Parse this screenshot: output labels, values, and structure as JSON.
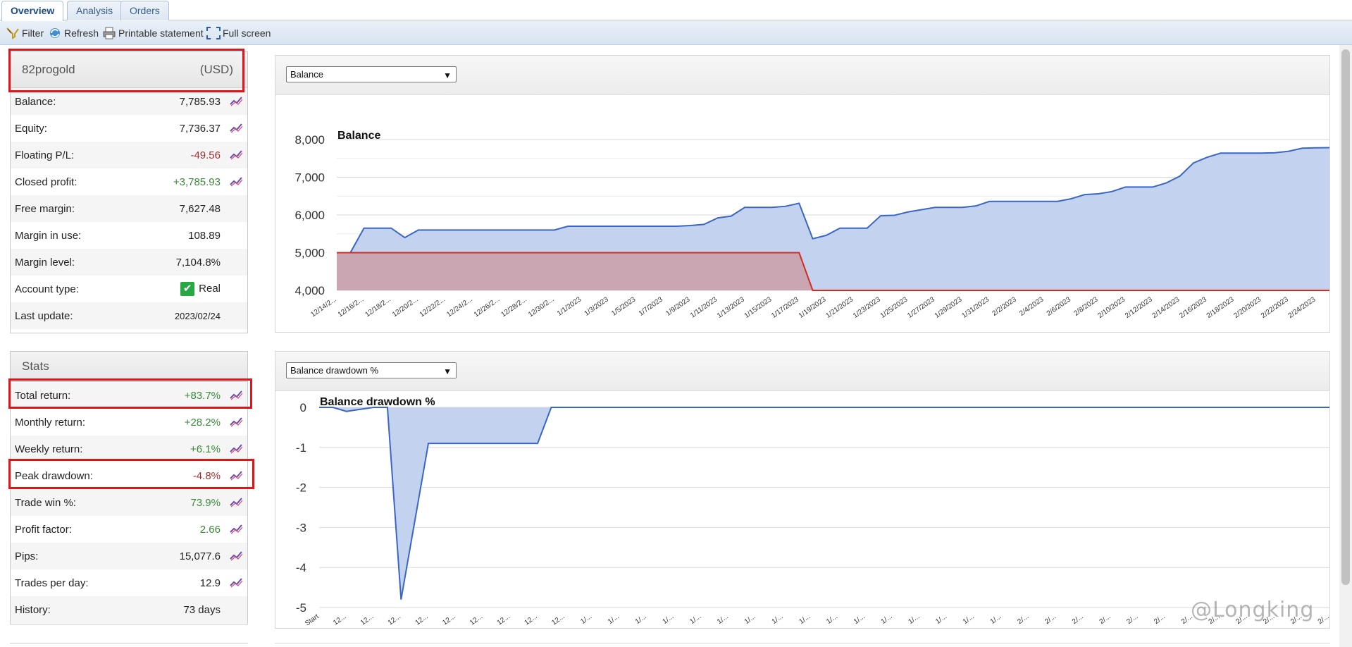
{
  "tabs": [
    {
      "label": "Overview",
      "active": true
    },
    {
      "label": "Analysis",
      "active": false
    },
    {
      "label": "Orders",
      "active": false
    }
  ],
  "toolbar": {
    "filter": "Filter",
    "refresh": "Refresh",
    "print": "Printable statement",
    "fullscreen": "Full screen"
  },
  "account": {
    "name": "82progold",
    "currency": "(USD)",
    "rows": [
      {
        "label": "Balance:",
        "value": "7,785.93",
        "style": "",
        "icon": true
      },
      {
        "label": "Equity:",
        "value": "7,736.37",
        "style": "",
        "icon": true
      },
      {
        "label": "Floating P/L:",
        "value": "-49.56",
        "style": "neg",
        "icon": true
      },
      {
        "label": "Closed profit:",
        "value": "+3,785.93",
        "style": "pos",
        "icon": true
      },
      {
        "label": "Free margin:",
        "value": "7,627.48",
        "style": "",
        "icon": false
      },
      {
        "label": "Margin in use:",
        "value": "108.89",
        "style": "",
        "icon": false
      },
      {
        "label": "Margin level:",
        "value": "7,104.8%",
        "style": "",
        "icon": false
      },
      {
        "label": "Account type:",
        "value": "Real",
        "style": "",
        "icon": false,
        "check": true
      },
      {
        "label": "Last update:",
        "value": "2023/02/24",
        "style": "small",
        "icon": false
      }
    ]
  },
  "stats": {
    "title": "Stats",
    "rows": [
      {
        "label": "Total return:",
        "value": "+83.7%",
        "style": "pos",
        "icon": true
      },
      {
        "label": "Monthly return:",
        "value": "+28.2%",
        "style": "pos",
        "icon": true
      },
      {
        "label": "Weekly return:",
        "value": "+6.1%",
        "style": "pos",
        "icon": true
      },
      {
        "label": "Peak drawdown:",
        "value": "-4.8%",
        "style": "neg",
        "icon": true
      },
      {
        "label": "Trade win %:",
        "value": "73.9%",
        "style": "pos",
        "icon": true
      },
      {
        "label": "Profit factor:",
        "value": "2.66",
        "style": "pos",
        "icon": true
      },
      {
        "label": "Pips:",
        "value": "15,077.6",
        "style": "",
        "icon": true
      },
      {
        "label": "Trades per day:",
        "value": "12.9",
        "style": "",
        "icon": true
      },
      {
        "label": "History:",
        "value": "73 days",
        "style": "",
        "icon": false
      }
    ]
  },
  "charts": {
    "balance_select": "Balance",
    "drawdown_select": "Balance drawdown %"
  },
  "watermark": "@Longking",
  "colors": {
    "balance_line": "#3a66c4",
    "balance_fill": "#c2d2ef",
    "deposit_line": "#d42a1e",
    "deposit_fill": "#c9a3ad",
    "highlight": "#e0141a"
  },
  "chart_data": [
    {
      "type": "area",
      "title": "Balance",
      "ylim": [
        4000,
        8000
      ],
      "yticks": [
        "8,000",
        "7,000",
        "6,000",
        "5,000",
        "4,000"
      ],
      "grid": true,
      "x": [
        "12/14/2...",
        "12/16/2...",
        "12/18/2...",
        "12/20/2...",
        "12/22/2...",
        "12/24/2...",
        "12/26/2...",
        "12/28/2...",
        "12/30/2...",
        "1/1/2023",
        "1/3/2023",
        "1/5/2023",
        "1/7/2023",
        "1/9/2023",
        "1/11/2023",
        "1/13/2023",
        "1/15/2023",
        "1/17/2023",
        "1/19/2023",
        "1/21/2023",
        "1/23/2023",
        "1/25/2023",
        "1/27/2023",
        "1/29/2023",
        "1/31/2023",
        "2/2/2023",
        "2/4/2023",
        "2/6/2023",
        "2/8/2023",
        "2/10/2023",
        "2/12/2023",
        "2/14/2023",
        "2/16/2023",
        "2/18/2023",
        "2/20/2023",
        "2/22/2023",
        "2/24/2023"
      ],
      "series": [
        {
          "values": [
            [
              0,
              5000
            ],
            [
              0.5,
              5000
            ],
            [
              1,
              5650
            ],
            [
              2,
              5650
            ],
            [
              2.5,
              5400
            ],
            [
              3,
              5600
            ],
            [
              4,
              5600
            ],
            [
              5,
              5600
            ],
            [
              6,
              5600
            ],
            [
              7,
              5600
            ],
            [
              8,
              5600
            ],
            [
              8.5,
              5700
            ],
            [
              9,
              5700
            ],
            [
              10,
              5700
            ],
            [
              11,
              5700
            ],
            [
              12,
              5700
            ],
            [
              12.5,
              5700
            ],
            [
              13,
              5720
            ],
            [
              13.5,
              5750
            ],
            [
              14,
              5920
            ],
            [
              14.5,
              5970
            ],
            [
              15,
              6200
            ],
            [
              16,
              6200
            ],
            [
              16.5,
              6230
            ],
            [
              17,
              6310
            ],
            [
              17.5,
              5370
            ],
            [
              18,
              5460
            ],
            [
              18.5,
              5650
            ],
            [
              19,
              5650
            ],
            [
              19.5,
              5650
            ],
            [
              20,
              5980
            ],
            [
              20.5,
              5990
            ],
            [
              21,
              6080
            ],
            [
              21.5,
              6140
            ],
            [
              22,
              6200
            ],
            [
              22.5,
              6200
            ],
            [
              23,
              6200
            ],
            [
              23.5,
              6240
            ],
            [
              24,
              6360
            ],
            [
              25,
              6360
            ],
            [
              26,
              6360
            ],
            [
              26.5,
              6360
            ],
            [
              27,
              6430
            ],
            [
              27.5,
              6540
            ],
            [
              28,
              6560
            ],
            [
              28.5,
              6620
            ],
            [
              29,
              6740
            ],
            [
              30,
              6740
            ],
            [
              30.5,
              6850
            ],
            [
              31,
              7030
            ],
            [
              31.5,
              7380
            ],
            [
              32,
              7530
            ],
            [
              32.5,
              7640
            ],
            [
              33,
              7640
            ],
            [
              34,
              7640
            ],
            [
              34.5,
              7650
            ],
            [
              35,
              7690
            ],
            [
              35.5,
              7770
            ],
            [
              36,
              7780
            ],
            [
              36.5,
              7786
            ]
          ]
        },
        {
          "values": [
            [
              0,
              5000
            ],
            [
              17,
              5000
            ],
            [
              17.5,
              4000
            ],
            [
              36.5,
              4000
            ]
          ]
        }
      ]
    },
    {
      "type": "area",
      "title": "Balance drawdown %",
      "ylim": [
        -5,
        0
      ],
      "yticks": [
        "0",
        "-1",
        "-2",
        "-3",
        "-4",
        "-5"
      ],
      "grid": true,
      "x": [
        "Start",
        "12...",
        "12...",
        "12...",
        "12...",
        "12...",
        "12...",
        "12...",
        "12...",
        "12...",
        "1/...",
        "1/...",
        "1/...",
        "1/...",
        "1/...",
        "1/...",
        "1/...",
        "1/...",
        "1/...",
        "1/...",
        "1/...",
        "1/...",
        "1/...",
        "1/...",
        "1/...",
        "1/...",
        "2/...",
        "2/...",
        "2/...",
        "2/...",
        "2/...",
        "2/...",
        "2/...",
        "2/...",
        "2/...",
        "2/...",
        "2/...",
        "2/..."
      ],
      "series": [
        {
          "values": [
            [
              0,
              0
            ],
            [
              0.5,
              0
            ],
            [
              1,
              -0.1
            ],
            [
              2,
              0
            ],
            [
              2.5,
              0
            ],
            [
              3,
              -4.8
            ],
            [
              4,
              -0.9
            ],
            [
              5,
              -0.9
            ],
            [
              6,
              -0.9
            ],
            [
              7,
              -0.9
            ],
            [
              8,
              -0.9
            ],
            [
              8.5,
              0
            ],
            [
              37,
              0
            ]
          ]
        }
      ]
    }
  ]
}
